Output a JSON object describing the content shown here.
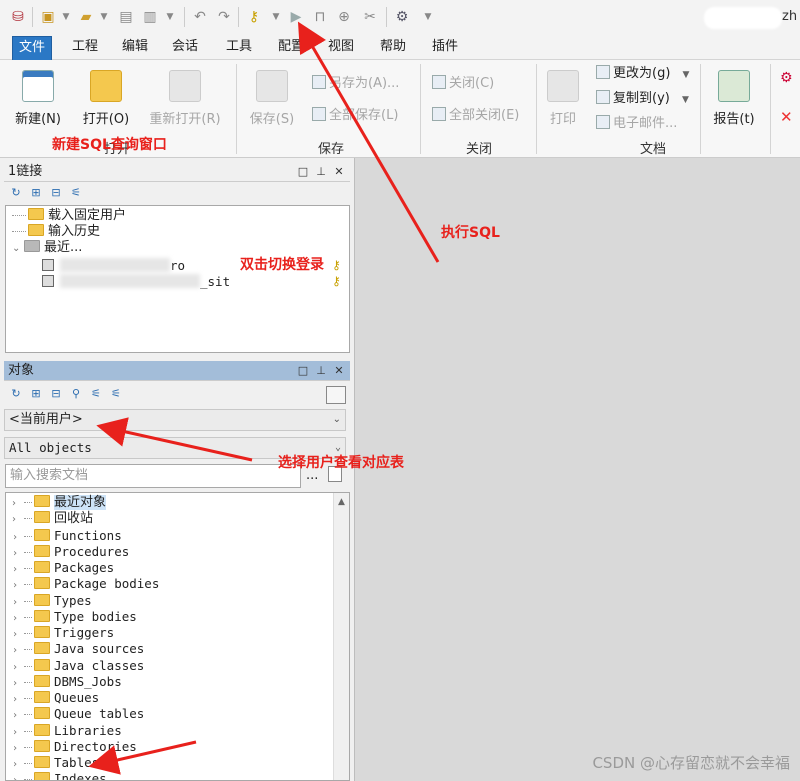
{
  "window": {
    "user_suffix": "zh"
  },
  "tabs": [
    "文件",
    "工程",
    "编辑",
    "会话",
    "工具",
    "配置",
    "视图",
    "帮助",
    "插件"
  ],
  "ribbon": {
    "new_label": "新建(N)",
    "open_label": "打开(O)",
    "reopen_label": "重新打开(R)",
    "save_label": "保存(S)",
    "save_as_label": "另存为(A)...",
    "save_all_label": "全部保存(L)",
    "close_label": "关闭(C)",
    "close_all_label": "全部关闭(E)",
    "print_label": "打印",
    "change_to_label": "更改为(g)",
    "copy_to_label": "复制到(y)",
    "email_label": "电子邮件...",
    "report_label": "报告(t)",
    "group_open": "打开",
    "group_save": "保存",
    "group_close": "关闭",
    "group_doc": "文档"
  },
  "connections_panel": {
    "title": "1链接",
    "items": [
      "载入固定用户",
      "输入历史",
      "最近..."
    ],
    "recent_children": [
      "ro",
      "_sit"
    ]
  },
  "objects_panel": {
    "title": "对象",
    "user_select": "<当前用户>",
    "filter_select": "All objects",
    "search_placeholder": "输入搜索文档",
    "tree": [
      "最近对象",
      "回收站",
      "Functions",
      "Procedures",
      "Packages",
      "Package bodies",
      "Types",
      "Type bodies",
      "Triggers",
      "Java sources",
      "Java classes",
      "DBMS_Jobs",
      "Queues",
      "Queue tables",
      "Libraries",
      "Directories",
      "Tables",
      "Indexes"
    ]
  },
  "annotations": {
    "new_sql": "新建SQL查询窗口",
    "execute_sql": "执行SQL",
    "double_click": "双击切换登录",
    "select_user": "选择用户查看对应表"
  },
  "watermark": "CSDN @心存留恋就不会幸福",
  "colors": {
    "accent": "#2b78c5",
    "annotation": "#e8211c",
    "panel_header": "#a3bdd9"
  }
}
